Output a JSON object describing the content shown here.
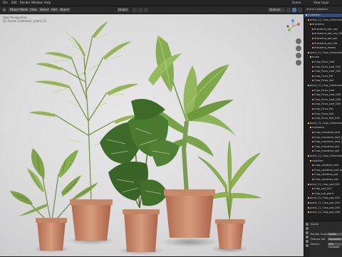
{
  "menu": [
    "File",
    "Edit",
    "Render",
    "Window",
    "Help"
  ],
  "topbar_right": [
    "Scene",
    "View Layer"
  ],
  "viewport_header": {
    "mode": "Object Mode",
    "view": "View",
    "select": "Select",
    "add": "Add",
    "object": "Object",
    "transform": "Global",
    "overlays_label": "Options"
  },
  "viewport_overlay": {
    "line1": "User Perspective",
    "line2": "(1) Scene Collection | plant_11"
  },
  "outliner": {
    "title": "Scene Collection",
    "rows": [
      {
        "label": "Collection",
        "color": "#e7e7e7",
        "level": 0,
        "selected": true
      },
      {
        "label": "plant_11_Crop_Collection",
        "color": "#e7b86a",
        "level": 1
      },
      {
        "label": "dracaena",
        "color": "#e7b86a",
        "level": 2
      },
      {
        "label": "dracaena_pot_cap",
        "color": "#d97b7b",
        "level": 3
      },
      {
        "label": "dracaena_pot_cap_001",
        "color": "#d97b7b",
        "level": 3
      },
      {
        "label": "dracaena_pot_soil",
        "color": "#d97b7b",
        "level": 3
      },
      {
        "label": "dracaena_pot_dirt",
        "color": "#d97b7b",
        "level": 3
      },
      {
        "label": "dracaena_leaves",
        "color": "#d97b7b",
        "level": 3
      },
      {
        "label": "plant_11_Crop_Collection_001",
        "color": "#e7b86a",
        "level": 1
      },
      {
        "label": "musa",
        "color": "#e7b86a",
        "level": 2
      },
      {
        "label": "Crop_Ficus_Leaf",
        "color": "#d97b7b",
        "level": 3
      },
      {
        "label": "Crop_Ficus_Leaf_001",
        "color": "#d97b7b",
        "level": 3
      },
      {
        "label": "Crop_Ficus_Leaf_002",
        "color": "#d97b7b",
        "level": 3
      },
      {
        "label": "Crop_Ficus_Pot",
        "color": "#d97b7b",
        "level": 3
      },
      {
        "label": "Crop_Ficus_Soil",
        "color": "#d97b7b",
        "level": 3
      },
      {
        "label": "plant_11_Crop_Collection_002",
        "color": "#e7b86a",
        "level": 1
      },
      {
        "label": "Crop_Ficus_Leaf",
        "color": "#d97b7b",
        "level": 3
      },
      {
        "label": "Crop_Ficus_Leaf_003",
        "color": "#d97b7b",
        "level": 3
      },
      {
        "label": "Crop_Ficus_Leaf_004",
        "color": "#d97b7b",
        "level": 3
      },
      {
        "label": "Crop_Ficus_Leaf_005",
        "color": "#d97b7b",
        "level": 3
      },
      {
        "label": "Crop_Ficus_Pot",
        "color": "#d97b7b",
        "level": 3
      },
      {
        "label": "Crop_Ficus_Soil",
        "color": "#d97b7b",
        "level": 3
      },
      {
        "label": "Crop_Ficus_Soil_001",
        "color": "#d97b7b",
        "level": 3
      },
      {
        "label": "plant_11_Crop_Collection_003",
        "color": "#e7b86a",
        "level": 1
      },
      {
        "label": "monstera",
        "color": "#e7b86a",
        "level": 2
      },
      {
        "label": "Crop_monstera_leaf",
        "color": "#d97b7b",
        "level": 3
      },
      {
        "label": "Crop_monstera_leaf_001",
        "color": "#d97b7b",
        "level": 3
      },
      {
        "label": "Crop_monstera_leaf_002",
        "color": "#d97b7b",
        "level": 3
      },
      {
        "label": "Crop_monstera_pot",
        "color": "#d97b7b",
        "level": 3
      },
      {
        "label": "Crop_monstera_soil",
        "color": "#d97b7b",
        "level": 3
      },
      {
        "label": "plant_11_Crop_Collection_004",
        "color": "#e7b86a",
        "level": 1
      },
      {
        "label": "calathea",
        "color": "#e7b86a",
        "level": 2
      },
      {
        "label": "Crop_calathea_leaf",
        "color": "#d97b7b",
        "level": 3
      },
      {
        "label": "Crop_calathea_leaf_001",
        "color": "#d97b7b",
        "level": 3
      },
      {
        "label": "Crop_calathea_pot",
        "color": "#d97b7b",
        "level": 3
      },
      {
        "label": "Crop_calathea_soil",
        "color": "#d97b7b",
        "level": 3
      },
      {
        "label": "plant_11_Crop_pot_001",
        "color": "#e7b86a",
        "level": 1
      },
      {
        "label": "Crop_pot_002",
        "color": "#d97b7b",
        "level": 3
      },
      {
        "label": "Crop_pot_plant",
        "color": "#d97b7b",
        "level": 3
      },
      {
        "label": "plant_11_Crop_pot_003",
        "color": "#e7b86a",
        "level": 1
      },
      {
        "label": "plant_11_Crop_pot_004",
        "color": "#e7b86a",
        "level": 1
      },
      {
        "label": "plant_11_Crop_pot_005",
        "color": "#e7b86a",
        "level": 1
      },
      {
        "label": "plant_11_Crop_pot_006",
        "color": "#e7b86a",
        "level": 1
      }
    ]
  },
  "properties": {
    "title": "Scene",
    "render_engine_label": "Render Engine",
    "render_engine_value": "Cycles",
    "feature_set_label": "Feature Set",
    "feature_set_value": "Supported",
    "device_label": "Device",
    "device_value": "GPU Compute"
  },
  "colors": {
    "accent": "#4772b3",
    "collection": "#e7b86a",
    "mesh": "#d97b7b"
  }
}
